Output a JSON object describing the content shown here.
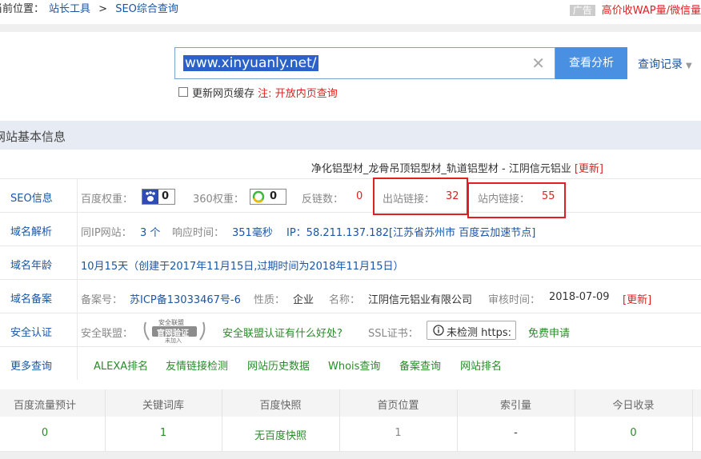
{
  "breadcrumb": {
    "prefix": "当前位置：",
    "items": [
      "站长工具",
      "SEO综合查询"
    ],
    "separator": ">"
  },
  "ad": {
    "tag": "广告",
    "text": "高价收WAP量/微信量"
  },
  "search": {
    "value": "www.xinyuanly.net/",
    "button_label": "查看分析",
    "history_label": "查询记录"
  },
  "cache": {
    "label": "更新网页缓存",
    "note_prefix": "注:",
    "note_link": "开放内页查询"
  },
  "section": {
    "title": "网站基本信息"
  },
  "site_title": {
    "text": "净化铝型材_龙骨吊顶铝型材_轨道铝型材 - 江阴信元铝业",
    "update": "[更新]"
  },
  "seo": {
    "label": "SEO信息",
    "baidu_weight_label": "百度权重：",
    "baidu_weight_value": "0",
    "w360_label": "360权重：",
    "w360_value": "0",
    "backlinks_label": "反链数：",
    "backlinks_value": "0",
    "outlinks_label": "出站链接：",
    "outlinks_value": "32",
    "inlinks_label": "站内链接：",
    "inlinks_value": "55"
  },
  "dns": {
    "label": "域名解析",
    "same_ip_label": "同IP网站：",
    "same_ip_value": "3 个",
    "resp_label": "响应时间：",
    "resp_value": "351毫秒",
    "ip_text": "IP：58.211.137.182[江苏省苏州市 百度云加速节点]"
  },
  "age": {
    "label": "域名年龄",
    "text": "10月15天（创建于2017年11月15日,过期时间为2018年11月15日）"
  },
  "icp": {
    "label": "域名备案",
    "no_label": "备案号：",
    "no_value": "苏ICP备13033467号-6",
    "nature_label": "性质：",
    "nature_value": "企业",
    "name_label": "名称：",
    "name_value": "江阴信元铝业有限公司",
    "audit_label": "审核时间：",
    "audit_value": "2018-07-09",
    "update": "[更新]"
  },
  "security": {
    "label": "安全认证",
    "alliance_label": "安全联盟：",
    "logo_top": "安全联盟",
    "logo_main": "官网验证",
    "logo_sub": "未加入",
    "alliance_link": "安全联盟认证有什么好处?",
    "ssl_label": "SSL证书：",
    "ssl_button": "未检测 https:",
    "ssl_apply": "免费申请"
  },
  "more": {
    "label": "更多查询",
    "links": [
      "ALEXA排名",
      "友情链接检测",
      "网站历史数据",
      "Whois查询",
      "备案查询",
      "网站排名"
    ]
  },
  "stats": {
    "headers": [
      "百度流量预计",
      "关键词库",
      "百度快照",
      "首页位置",
      "索引量",
      "今日收录"
    ],
    "values": [
      "0",
      "1",
      "无百度快照",
      "1",
      "-",
      "0"
    ]
  },
  "colors": {
    "accent": "#4a90e2",
    "link": "#1a56a6",
    "alert": "#e02020",
    "highlight_box": "#e02020"
  }
}
